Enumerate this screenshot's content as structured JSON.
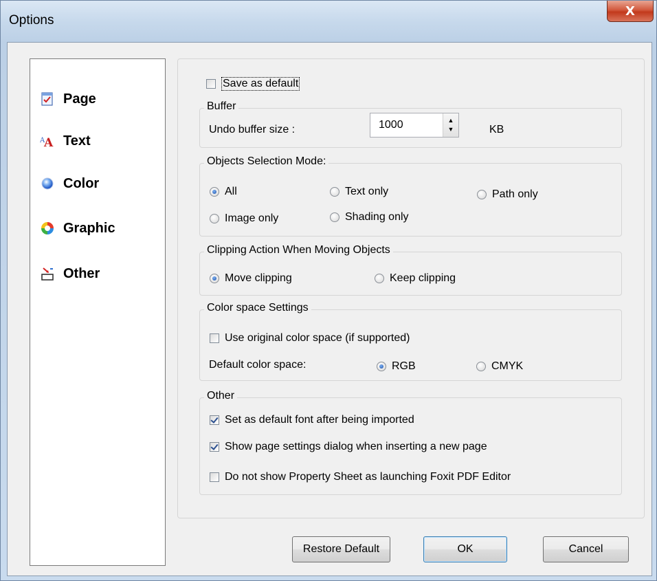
{
  "window": {
    "title": "Options",
    "close_label": "X"
  },
  "nav": {
    "items": [
      {
        "label": "Page",
        "icon": "page-icon"
      },
      {
        "label": "Text",
        "icon": "text-icon"
      },
      {
        "label": "Color",
        "icon": "color-icon"
      },
      {
        "label": "Graphic",
        "icon": "graphic-icon"
      },
      {
        "label": "Other",
        "icon": "other-icon"
      }
    ]
  },
  "save_default": {
    "label": "Save as default",
    "checked": false
  },
  "buffer": {
    "title": "Buffer",
    "label": "Undo buffer size :",
    "value": "1000",
    "unit": "KB"
  },
  "selection_mode": {
    "title": "Objects Selection Mode:",
    "options": [
      {
        "label": "All",
        "selected": true
      },
      {
        "label": "Text only",
        "selected": false
      },
      {
        "label": "Path only",
        "selected": false
      },
      {
        "label": "Image only",
        "selected": false
      },
      {
        "label": "Shading only",
        "selected": false
      }
    ]
  },
  "clipping": {
    "title": "Clipping Action When Moving Objects",
    "options": [
      {
        "label": "Move clipping",
        "selected": true
      },
      {
        "label": "Keep clipping",
        "selected": false
      }
    ]
  },
  "color_space": {
    "title": "Color space Settings",
    "use_original": {
      "label": "Use original color space (if supported)",
      "checked": false
    },
    "default_label": "Default color space:",
    "options": [
      {
        "label": "RGB",
        "selected": true
      },
      {
        "label": "CMYK",
        "selected": false
      }
    ]
  },
  "other": {
    "title": "Other",
    "options": [
      {
        "label": "Set as default font after being imported",
        "checked": true
      },
      {
        "label": "Show page settings dialog when inserting a new page",
        "checked": true
      },
      {
        "label": "Do not show Property Sheet as launching Foxit PDF Editor",
        "checked": false
      }
    ]
  },
  "buttons": {
    "restore": "Restore Default",
    "ok": "OK",
    "cancel": "Cancel"
  }
}
